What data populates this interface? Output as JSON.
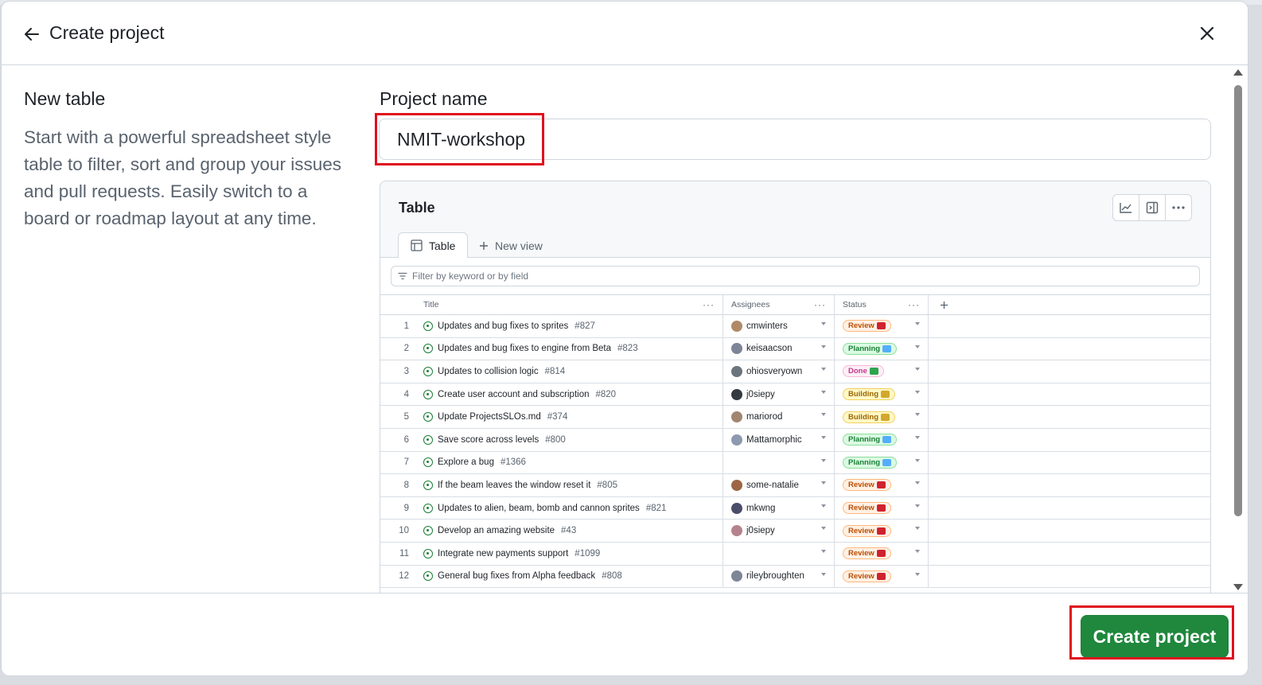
{
  "dialog": {
    "title": "Create project",
    "template": {
      "heading": "New table",
      "description": "Start with a powerful spreadsheet style table to filter, sort and group your issues and pull requests. Easily switch to a board or roadmap layout at any time."
    },
    "project_name": {
      "label": "Project name",
      "value": "NMIT-workshop"
    },
    "create_label": "Create project"
  },
  "preview": {
    "title": "Table",
    "tabs": {
      "active": "Table",
      "new_view": "New view"
    },
    "filter_placeholder": "Filter by keyword or by field",
    "columns": {
      "title": "Title",
      "assignees": "Assignees",
      "status": "Status"
    },
    "rows": [
      {
        "n": "1",
        "title": "Updates and bug fixes to sprites",
        "ref": "#827",
        "assignee": "cmwinters",
        "status": "Review"
      },
      {
        "n": "2",
        "title": "Updates and bug fixes to engine from Beta",
        "ref": "#823",
        "assignee": "keisaacson",
        "status": "Planning"
      },
      {
        "n": "3",
        "title": "Updates to collision logic",
        "ref": "#814",
        "assignee": "ohiosveryown",
        "status": "Done"
      },
      {
        "n": "4",
        "title": "Create user account and subscription",
        "ref": "#820",
        "assignee": "j0siepy",
        "status": "Building"
      },
      {
        "n": "5",
        "title": "Update ProjectsSLOs.md",
        "ref": "#374",
        "assignee": "mariorod",
        "status": "Building"
      },
      {
        "n": "6",
        "title": "Save score across levels",
        "ref": "#800",
        "assignee": "Mattamorphic",
        "status": "Planning"
      },
      {
        "n": "7",
        "title": "Explore a bug",
        "ref": "#1366",
        "assignee": "",
        "status": "Planning"
      },
      {
        "n": "8",
        "title": "If the beam leaves the window reset it",
        "ref": "#805",
        "assignee": "some-natalie",
        "status": "Review"
      },
      {
        "n": "9",
        "title": "Updates to alien, beam, bomb and cannon sprites",
        "ref": "#821",
        "assignee": "mkwng",
        "status": "Review"
      },
      {
        "n": "10",
        "title": "Develop an amazing website",
        "ref": "#43",
        "assignee": "j0siepy",
        "status": "Review"
      },
      {
        "n": "11",
        "title": "Integrate new payments support",
        "ref": "#1099",
        "assignee": "",
        "status": "Review"
      },
      {
        "n": "12",
        "title": "General bug fixes from Alpha feedback",
        "ref": "#808",
        "assignee": "rileybroughten",
        "status": "Review"
      }
    ]
  },
  "colors": {
    "primary_button": "#1f883d",
    "highlight_box": "#e0101e",
    "status_review": "#bc4c00",
    "status_planning": "#1a7f37",
    "status_done": "#bf3989",
    "status_building": "#9a6700"
  }
}
